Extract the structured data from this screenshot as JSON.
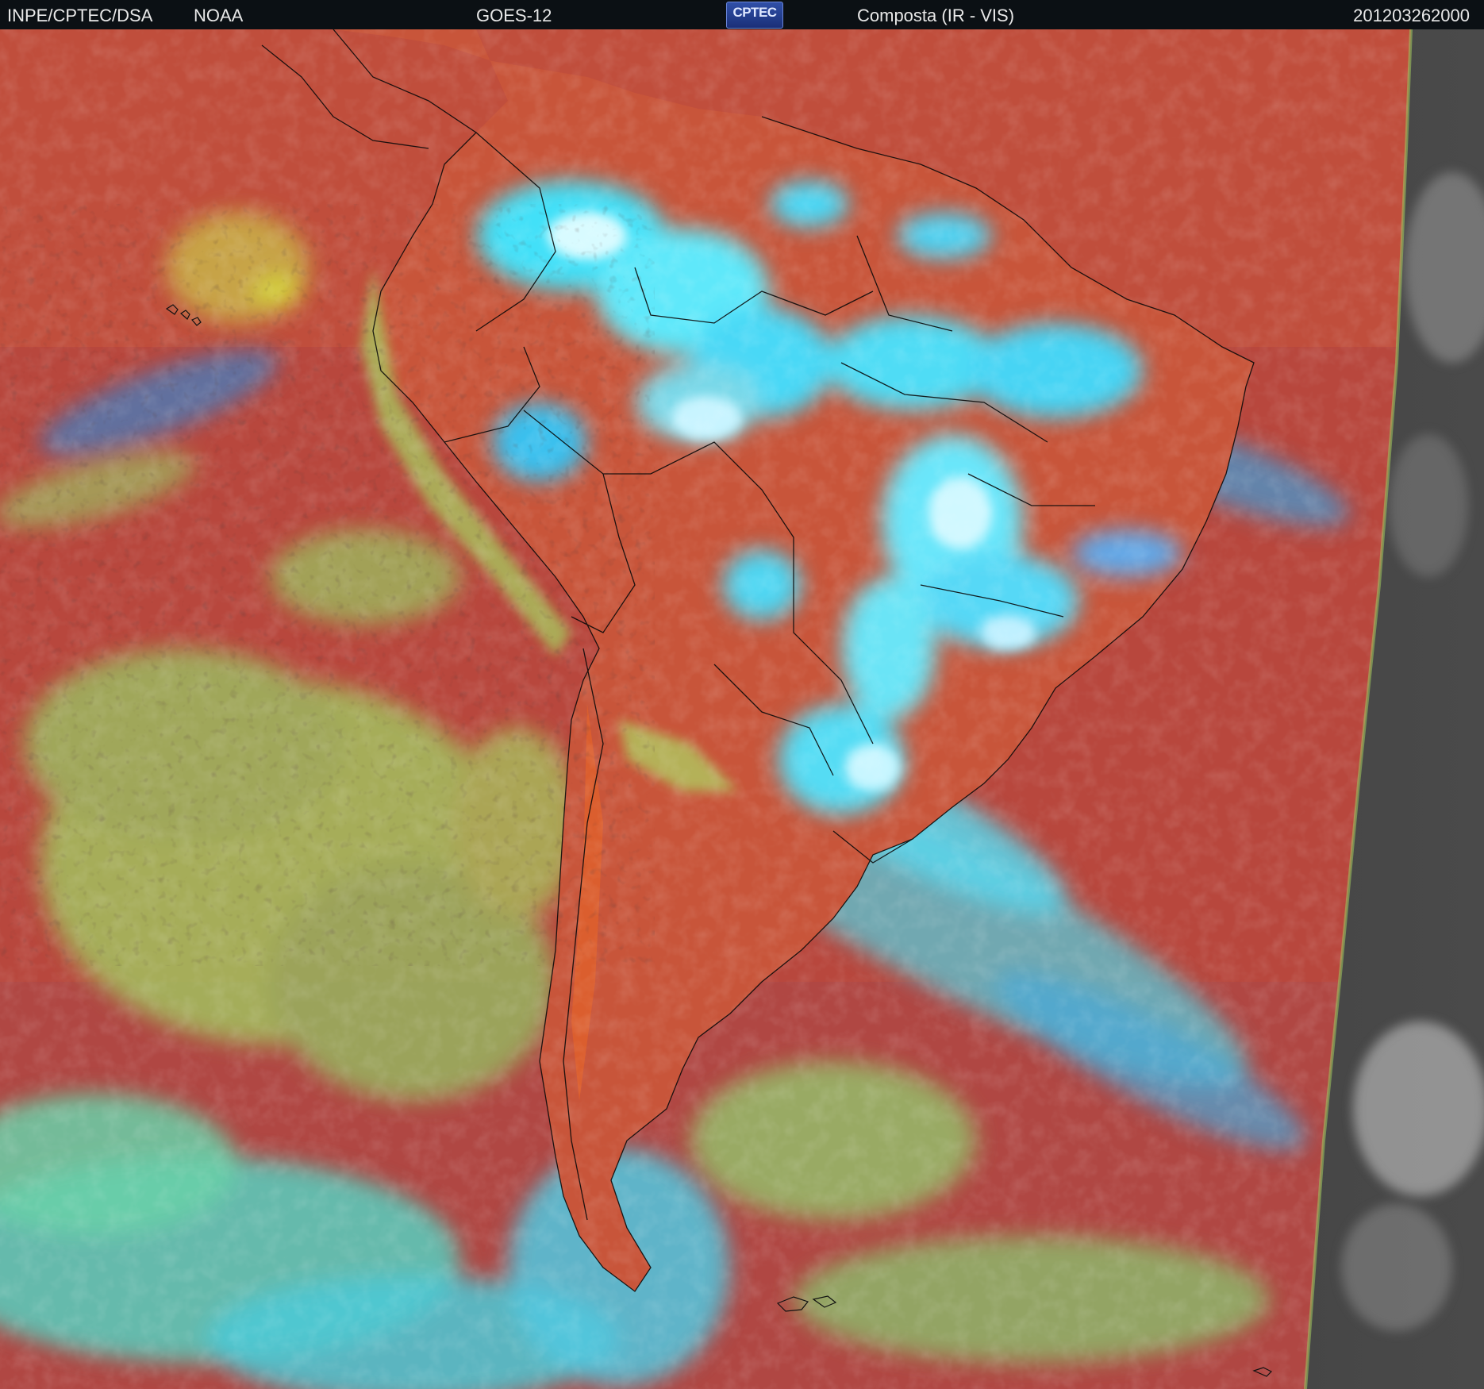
{
  "header": {
    "source": "INPE/CPTEC/DSA",
    "agency": "NOAA",
    "satellite": "GOES-12",
    "logo_text": "CPTEC",
    "product": "Composta (IR - VIS)",
    "timestamp": "201203262000"
  },
  "colors": {
    "header_bg": "#0b1014",
    "ocean_clear": "#b8473d",
    "land_clear": "#c5502f",
    "deep_convection": "#38d8f2",
    "low_cloud": "#a4c85a",
    "off_disk": "#3c3c3c",
    "border_lines": "#0a0a0a"
  },
  "icons": {
    "logo": "cptec-logo"
  }
}
